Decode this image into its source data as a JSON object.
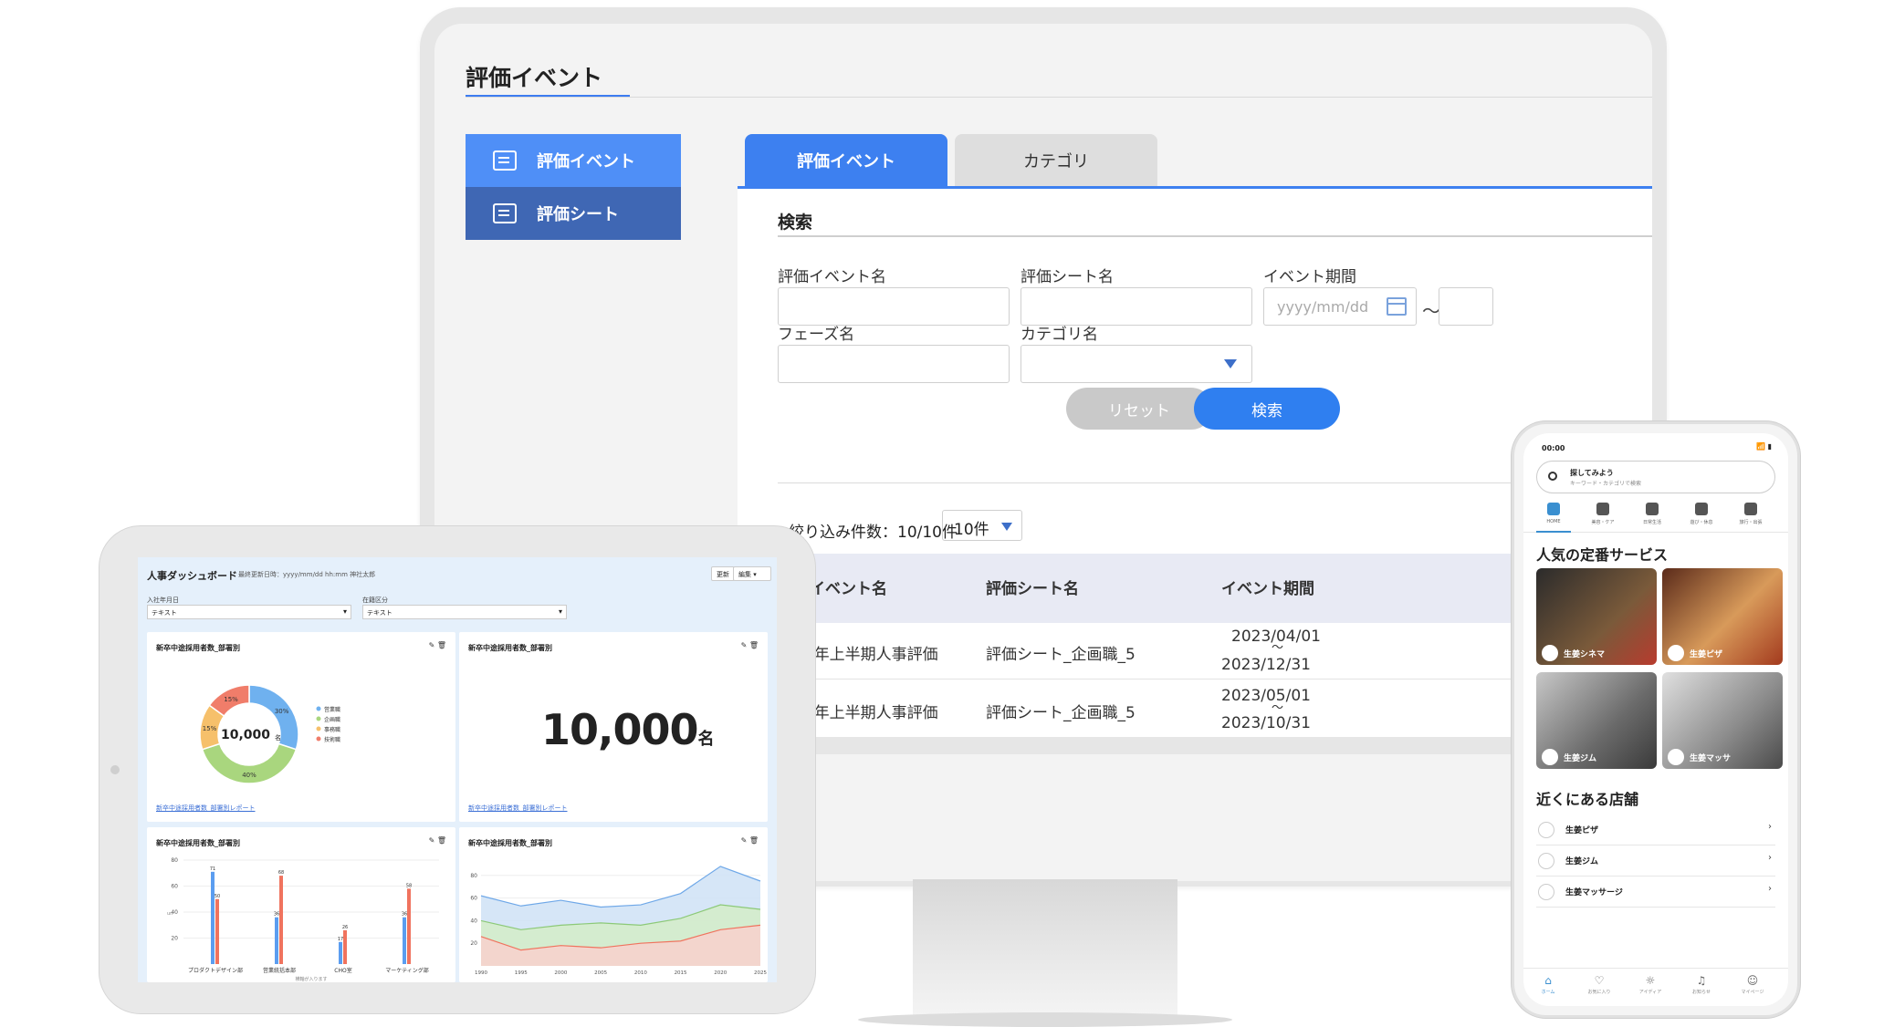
{
  "desktop": {
    "page_title": "評価イベント",
    "sidebar": [
      {
        "label": "評価イベント",
        "icon": "calendar-settings-icon"
      },
      {
        "label": "評価シート",
        "icon": "sheet-icon"
      }
    ],
    "tabs": [
      {
        "label": "評価イベント"
      },
      {
        "label": "カテゴリ"
      }
    ],
    "search": {
      "title": "検索",
      "event_name_label": "評価イベント名",
      "sheet_name_label": "評価シート名",
      "period_label": "イベント期間",
      "period_placeholder": "yyyy/mm/dd",
      "period_separator": "～",
      "phase_label": "フェーズ名",
      "category_label": "カテゴリ名",
      "reset_label": "リセット",
      "search_label": "検索"
    },
    "results": {
      "count_label": "絞り込み件数：10/10件",
      "per_page": "10件",
      "columns": [
        "価イベント名",
        "評価シート名",
        "イベント期間"
      ],
      "rows": [
        {
          "event": "23年上半期人事評価",
          "sheet": "評価シート_企画職_5",
          "start": "2023/04/01",
          "sep": "～",
          "end": "2023/12/31"
        },
        {
          "event": "23年上半期人事評価",
          "sheet": "評価シート_企画職_5",
          "start": "2023/05/01",
          "sep": "～",
          "end": "2023/10/31"
        }
      ]
    }
  },
  "tablet": {
    "title": "人事ダッシュボード",
    "last_updated": "最終更新日時：yyyy/mm/dd hh:mm 神社太郎",
    "buttons": {
      "update": "更新",
      "edit": "編集"
    },
    "filter1": {
      "label": "入社年月日",
      "value": "テキスト"
    },
    "filter2": {
      "label": "在籍区分",
      "value": "テキスト"
    },
    "cards": [
      {
        "title": "新卒中途採用者数_部署別",
        "link": "新卒中途採用者数_部署別レポート",
        "icons": "✎ 🗑"
      },
      {
        "title": "新卒中途採用者数_部署別",
        "link": "新卒中途採用者数_部署別レポート",
        "icons": "✎ 🗑"
      },
      {
        "title": "新卒中途採用者数_部署別",
        "icons": "✎ 🗑"
      },
      {
        "title": "新卒中途採用者数_部署別",
        "icons": "✎ 🗑"
      }
    ],
    "kpi": {
      "value": "10,000",
      "unit": "名"
    }
  },
  "chart_data": [
    {
      "type": "pie",
      "title": "新卒中途採用者数_部署別",
      "center_label": "10,000",
      "center_unit": "名",
      "categories": [
        "営業職",
        "企画職",
        "事務職",
        "技術職"
      ],
      "values": [
        30,
        40,
        15,
        15
      ],
      "colors": [
        "#6fb1ef",
        "#a9d67e",
        "#f6c06b",
        "#f07d6a"
      ]
    },
    {
      "type": "bar",
      "title": "新卒中途採用者数_部署別",
      "categories": [
        "プロダクトデザイン部",
        "営業統括本部",
        "CHO室",
        "マーケティング部"
      ],
      "series": [
        {
          "values": [
            71,
            36,
            17,
            36
          ],
          "color": "#5b9df0"
        },
        {
          "values": [
            50,
            68,
            26,
            58
          ],
          "color": "#f0735e"
        }
      ],
      "ylim": [
        0,
        80
      ],
      "yticks": [
        20,
        40,
        60,
        80
      ],
      "ylabel": "un",
      "xlabel": "横軸が入ります"
    },
    {
      "type": "area",
      "title": "新卒中途採用者数_部署別",
      "x": [
        1990,
        1995,
        2000,
        2005,
        2010,
        2015,
        2020,
        2025
      ],
      "series": [
        {
          "values": [
            62,
            53,
            58,
            52,
            54,
            64,
            88,
            75
          ],
          "color": "#cfe2f6",
          "line": "#6fa8e8"
        },
        {
          "values": [
            40,
            32,
            36,
            38,
            36,
            42,
            54,
            50
          ],
          "color": "#d3ecc8",
          "line": "#8cc978"
        },
        {
          "values": [
            26,
            14,
            18,
            16,
            20,
            22,
            32,
            36
          ],
          "color": "#f8d1cc",
          "line": "#f0735e"
        }
      ],
      "ylim": [
        0,
        100
      ],
      "yticks": [
        20,
        40,
        60,
        80
      ]
    }
  ],
  "phone": {
    "time": "00:00",
    "status": "📶 ▮",
    "search_title": "探してみよう",
    "search_sub": "キーワード・カテゴリで検索",
    "categories": [
      "HOME",
      "美容・ケア",
      "日常生活",
      "遊び・休息",
      "旅行・出張"
    ],
    "popular_title": "人気の定番サービス",
    "tiles": [
      "生姜シネマ",
      "生姜ピザ",
      "生姜ジム",
      "生姜マッサ"
    ],
    "nearby_title": "近くにある店舗",
    "nearby": [
      "生姜ピザ",
      "生姜ジム",
      "生姜マッサージ"
    ],
    "nav": [
      "ホーム",
      "お気に入り",
      "アイディア",
      "お知らせ",
      "マイページ"
    ]
  }
}
